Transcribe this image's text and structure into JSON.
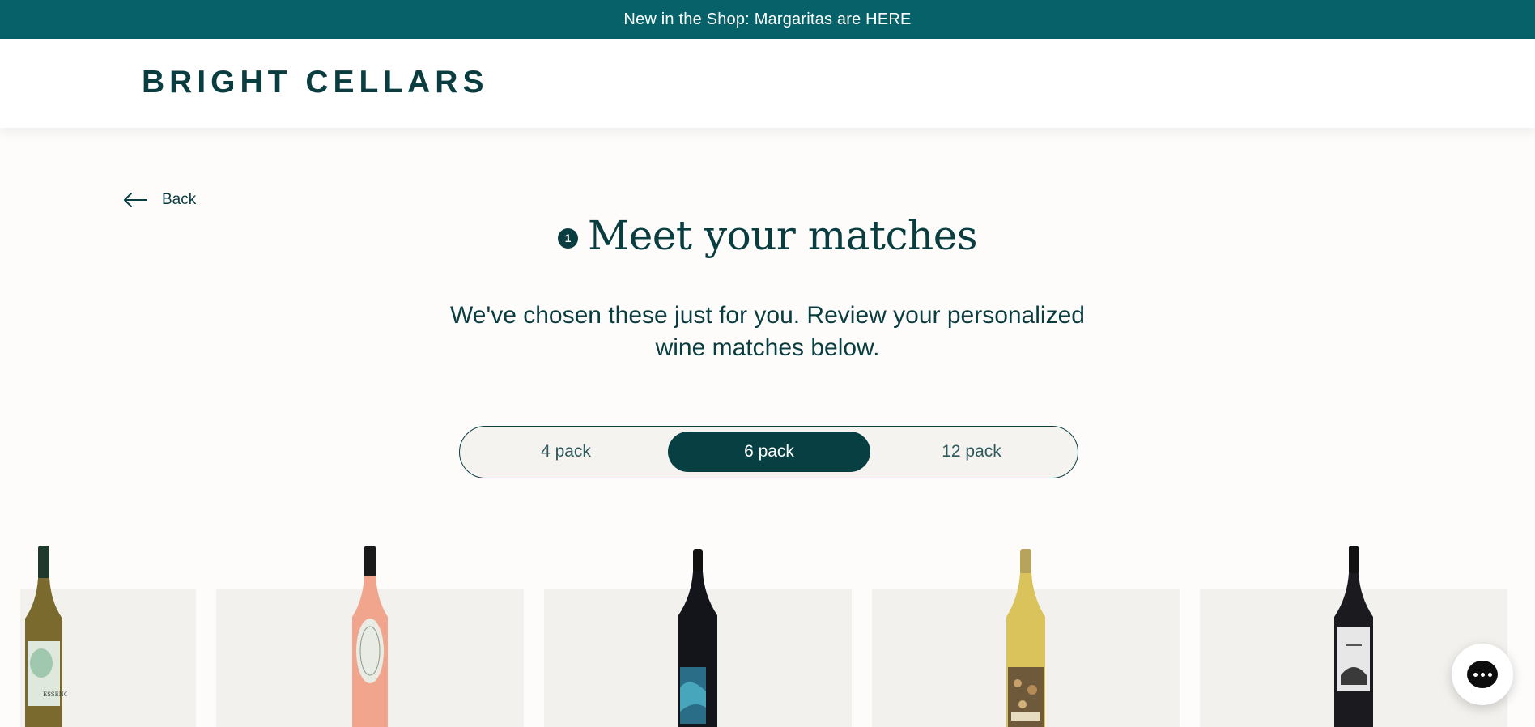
{
  "announcement": {
    "text": "New in the Shop: Margaritas are HERE"
  },
  "header": {
    "logo": "BRIGHT CELLARS"
  },
  "back": {
    "label": "Back",
    "icon": "arrow-left-icon"
  },
  "step": {
    "number": "1",
    "title": "Meet your matches"
  },
  "subtitle": "We've chosen these just for you. Review your personalized wine matches below.",
  "pack_options": [
    {
      "label": "4 pack",
      "active": false
    },
    {
      "label": "6 pack",
      "active": true
    },
    {
      "label": "12 pack",
      "active": false
    }
  ],
  "products": [
    {
      "name": "wine-bottle-white-green-label",
      "body_color": "#7a6a2e",
      "label_color": "#dfe8dc"
    },
    {
      "name": "wine-bottle-rose",
      "body_color": "#f0a58c",
      "label_color": "#e9ece4"
    },
    {
      "name": "wine-bottle-red-blue-label",
      "body_color": "#14151b",
      "label_color": "#2a6d86"
    },
    {
      "name": "wine-bottle-chardonnay",
      "body_color": "#d9c35a",
      "label_color": "#6e5a3a"
    },
    {
      "name": "wine-bottle-cabernet",
      "body_color": "#1b1b1f",
      "label_color": "#e7e7e7"
    }
  ],
  "colors": {
    "announcement_bg": "#076169",
    "brand": "#0a3d40",
    "card_bg": "#f3f1ed"
  },
  "chat": {
    "icon": "chat-bubble-icon"
  }
}
